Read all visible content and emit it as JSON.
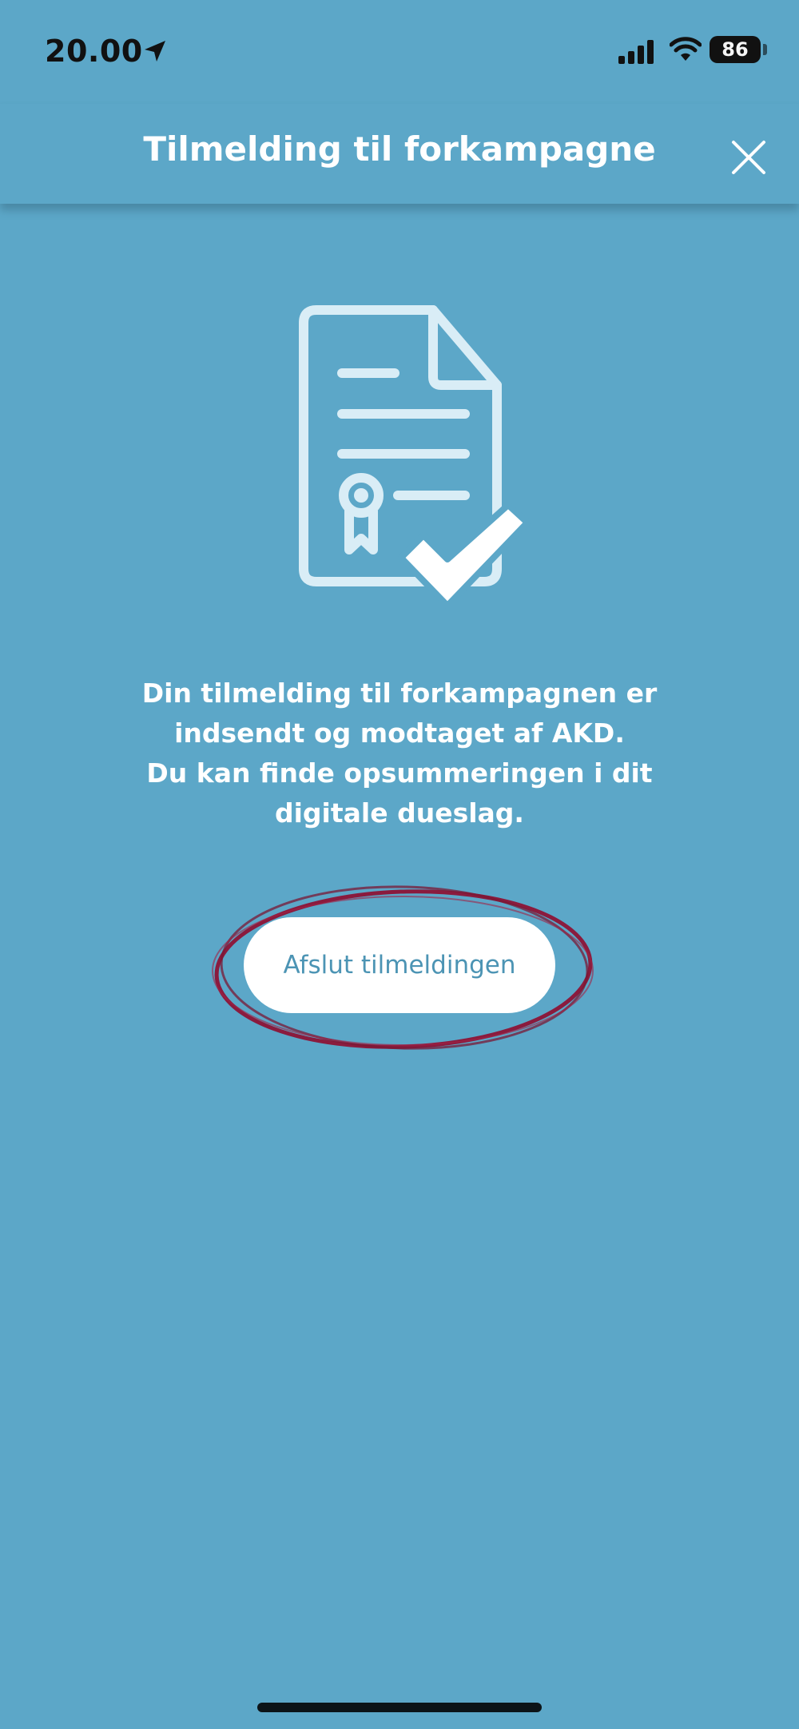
{
  "status_bar": {
    "time": "20.00",
    "battery": "86"
  },
  "header": {
    "title": "Tilmelding til forkampagne"
  },
  "message": {
    "line1": "Din tilmelding til forkampagnen er",
    "line2": "indsendt og modtaget af AKD.",
    "line3": "Du kan finde opsummeringen i dit",
    "line4": "digitale dueslag."
  },
  "actions": {
    "finish_label": "Afslut tilmeldingen"
  },
  "colors": {
    "background": "#5ca7c8",
    "button_text": "#4c94b4",
    "annotation": "#8a1b3e"
  },
  "icons": {
    "close": "close-icon",
    "illustration": "document-certificate-check-icon",
    "location": "location-arrow-icon",
    "signal": "cellular-signal-icon",
    "wifi": "wifi-icon"
  }
}
